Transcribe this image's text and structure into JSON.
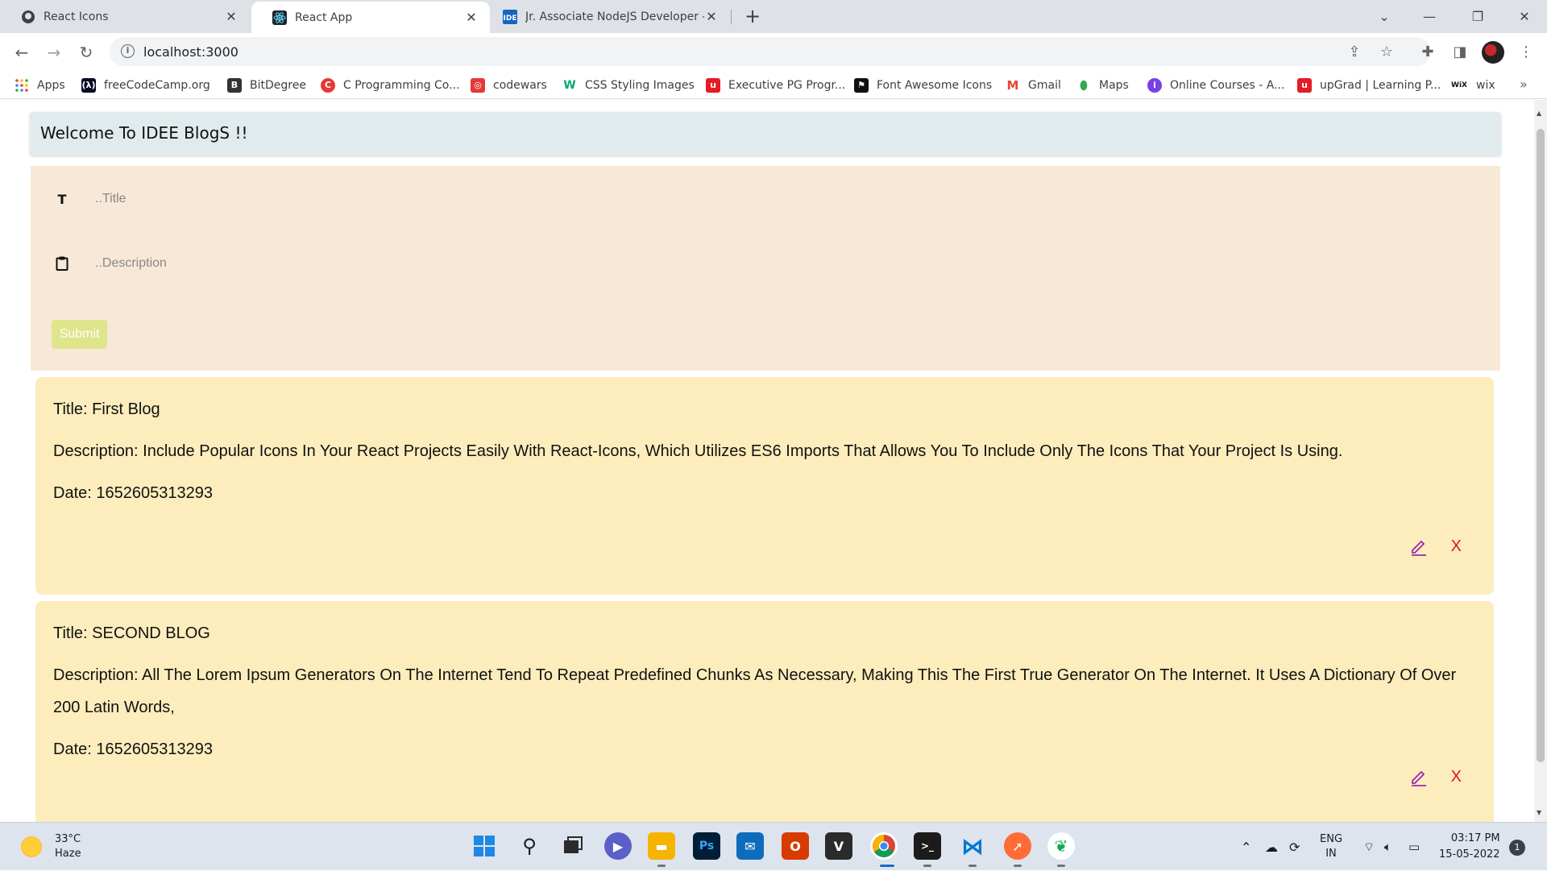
{
  "browser": {
    "tabs": [
      {
        "label": "React Icons",
        "icon": "github-icon"
      },
      {
        "label": "React App",
        "icon": "react-icon"
      },
      {
        "label": "Jr. Associate NodeJS Developer -",
        "icon": "idee-icon"
      }
    ],
    "url": "localhost:3000",
    "bookmarks": [
      {
        "label": "Apps",
        "icon": "apps-grid-icon",
        "color": "#ea4335"
      },
      {
        "label": "freeCodeCamp.org",
        "icon": "freecodecamp-icon",
        "color": "#0a0a23"
      },
      {
        "label": "BitDegree",
        "icon": "bitdegree-icon",
        "color": "#333333"
      },
      {
        "label": "C Programming Co...",
        "icon": "c-programming-icon",
        "color": "#e53935"
      },
      {
        "label": "codewars",
        "icon": "codewars-icon",
        "color": "#e53935"
      },
      {
        "label": "CSS Styling Images",
        "icon": "w3schools-icon",
        "color": "#04aa6d"
      },
      {
        "label": "Executive PG Progr...",
        "icon": "upgrad-icon",
        "color": "#e31c25"
      },
      {
        "label": "Font Awesome Icons",
        "icon": "fontawesome-icon",
        "color": "#111111"
      },
      {
        "label": "Gmail",
        "icon": "gmail-icon",
        "color": "#ea4335"
      },
      {
        "label": "Maps",
        "icon": "maps-icon",
        "color": "#34a853"
      },
      {
        "label": "Online Courses - A...",
        "icon": "online-courses-icon",
        "color": "#7b3fe4"
      },
      {
        "label": "upGrad | Learning P...",
        "icon": "upgrad-icon",
        "color": "#e31c25"
      },
      {
        "label": "wix",
        "icon": "wix-icon",
        "color": "#111111"
      }
    ]
  },
  "page": {
    "welcome": "Welcome To IDEE BlogS !!",
    "form": {
      "title_placeholder": "..Title",
      "title_value": "",
      "description_placeholder": "..Description",
      "description_value": "",
      "submit_label": "Submit"
    },
    "blogs": [
      {
        "title": "Title: First Blog",
        "description": "Description: Include Popular Icons In Your React Projects Easily With React-Icons, Which Utilizes ES6 Imports That Allows You To Include Only The Icons That Your Project Is Using.",
        "date": "Date: 1652605313293",
        "delete_label": "X"
      },
      {
        "title": "Title: SECOND BLOG",
        "description": "Description: All The Lorem Ipsum Generators On The Internet Tend To Repeat Predefined Chunks As Necessary, Making This The First True Generator On The Internet. It Uses A Dictionary Of Over 200 Latin Words,",
        "date": "Date: 1652605313293",
        "delete_label": "X"
      }
    ]
  },
  "taskbar": {
    "weather_temp": "33°C",
    "weather_desc": "Haze",
    "language_1": "ENG",
    "language_2": "IN",
    "time": "03:17 PM",
    "date": "15-05-2022",
    "notification_count": "1"
  },
  "colors": {
    "welcome_bg": "#e1ebed",
    "form_bg": "#f8e8d7",
    "card_bg": "#fdedbd",
    "submit_bg": "#dfe58a",
    "edit_icon": "#9c27b0",
    "delete_icon": "#e0141e"
  }
}
